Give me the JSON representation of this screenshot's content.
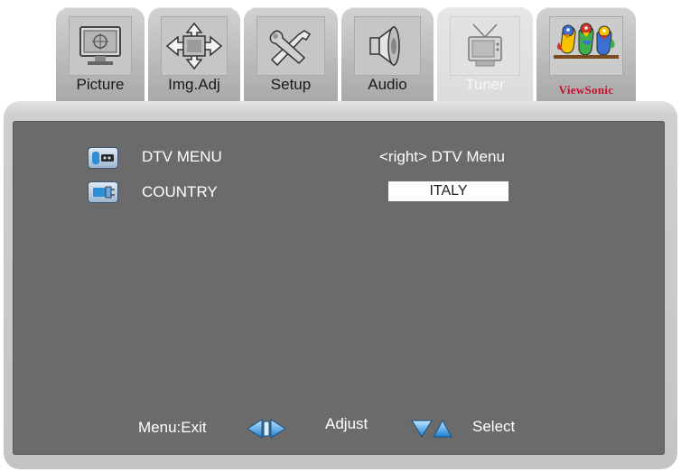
{
  "tabs": [
    {
      "label": "Picture",
      "icon": "monitor-icon"
    },
    {
      "label": "Img.Adj",
      "icon": "move-arrows-icon"
    },
    {
      "label": "Setup",
      "icon": "tools-icon"
    },
    {
      "label": "Audio",
      "icon": "speaker-icon"
    },
    {
      "label": "Tuner",
      "icon": "tv-antenna-icon",
      "active": true
    },
    {
      "label": "ViewSonic",
      "icon": "viewsonic-birds-logo"
    }
  ],
  "menu": {
    "items": [
      {
        "label": "DTV MENU",
        "icon": "dtv-icon",
        "value": "<right> DTV Menu"
      },
      {
        "label": "COUNTRY",
        "icon": "country-icon",
        "value": "ITALY"
      }
    ]
  },
  "footer": {
    "exit": "Menu:Exit",
    "adjust": "Adjust",
    "select": "Select"
  },
  "colors": {
    "panel": "#6b6b6b",
    "icon_blue": "#2f8fd6",
    "brand_red": "#c8102e"
  }
}
